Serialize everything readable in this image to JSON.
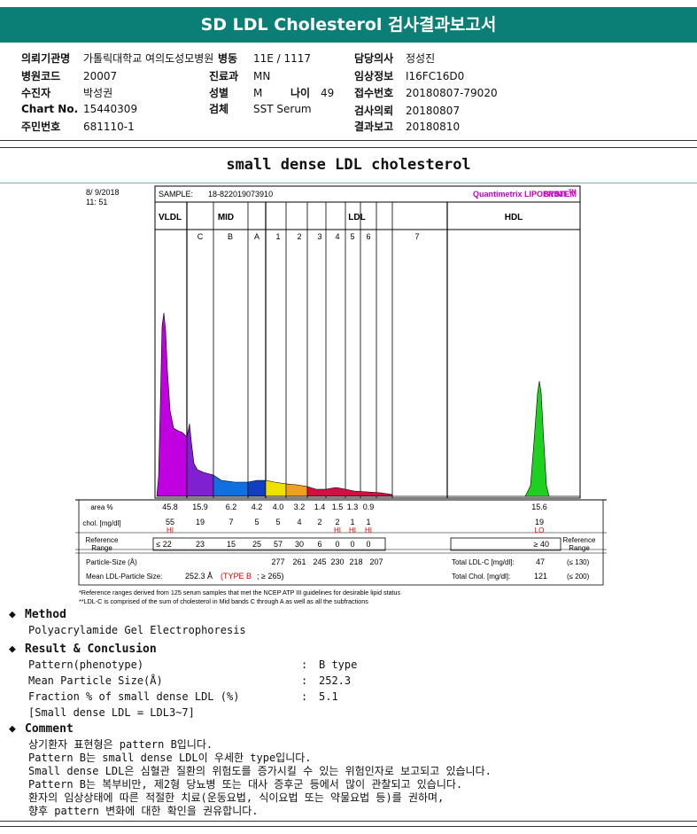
{
  "title": "SD LDL Cholesterol 검사결과보고서",
  "info": {
    "col1": [
      {
        "label": "의뢰기관명",
        "value": "가톨릭대학교 여의도성모병원"
      },
      {
        "label": "병원코드",
        "value": "20007"
      },
      {
        "label": "수진자",
        "value": "박성권"
      },
      {
        "label": "Chart No.",
        "value": "15440309"
      },
      {
        "label": "주민번호",
        "value": "681110-1"
      }
    ],
    "col2": [
      {
        "label": "병동",
        "value": "11E / 1117"
      },
      {
        "label": "진료과",
        "value": "MN"
      },
      {
        "label": "성별",
        "value": "M"
      },
      {
        "label": "검체",
        "value": "SST Serum"
      }
    ],
    "age_label": "나이",
    "age_value": "49",
    "col3": [
      {
        "label": "담당의사",
        "value": "정성진"
      },
      {
        "label": "임상정보",
        "value": "I16FC16D0"
      },
      {
        "label": "접수번호",
        "value": "20180807-79020"
      },
      {
        "label": "검사의뢰",
        "value": "20180807"
      },
      {
        "label": "결과보고",
        "value": "20180810"
      }
    ]
  },
  "subtitle": "small dense LDL cholesterol",
  "chart": {
    "date": "8/ 9/2018",
    "time": "11: 51",
    "sample_label": "SAMPLE:",
    "sample_value": "18-822019073910",
    "system_label": "Quantimetrix LIPOPRINT",
    "system_tm": "TM",
    "system_suffix": " SYSTEM",
    "group_labels": {
      "vldl": "VLDL",
      "mid": "MID",
      "ldl": "LDL",
      "hdl": "HDL"
    },
    "band_labels": [
      "C",
      "B",
      "A",
      "1",
      "2",
      "3",
      "4",
      "5",
      "6",
      "7"
    ],
    "row_labels": {
      "area": "area %",
      "chol": "chol. [mg/dl]",
      "ref": "Reference Range",
      "ref_right": "Reference Range",
      "particle": "Particle-Size (Å)",
      "mean": "Mean LDL-Particle Size:"
    },
    "area_values": [
      "45.8",
      "15.9",
      "6.2",
      "4.2",
      "4.0",
      "3.2",
      "1.4",
      "1.5",
      "1.3",
      "0.9"
    ],
    "hdl_area": "15.6",
    "chol_values": [
      "55",
      "19",
      "7",
      "5",
      "5",
      "4",
      "2",
      "2",
      "1",
      "1"
    ],
    "chol_flags": [
      "HI",
      "",
      "",
      "",
      "",
      "",
      "",
      "HI",
      "HI",
      "HI"
    ],
    "hdl_chol": "19",
    "hdl_flag": "LO",
    "ref_values": [
      "≤ 22",
      "23",
      "15",
      "25",
      "57",
      "30",
      "6",
      "0",
      "0",
      "0"
    ],
    "hdl_ref": "≥ 40",
    "particle_sizes": [
      "277",
      "261",
      "245",
      "230",
      "218",
      "207"
    ],
    "mean_value": "252.3 Å",
    "mean_type": "(TYPE B",
    "mean_suffix": "; ≥ 265)",
    "total_ldl_label": "Total LDL-C [mg/dl]:",
    "total_ldl_value": "47",
    "total_ldl_ref": "(≤ 130)",
    "total_chol_label": "Total Chol. [mg/dl]:",
    "total_chol_value": "121",
    "total_chol_ref": "(≤ 200)",
    "footnote1": "*Reference ranges derived from 125 serum samples that met the NCEP ATP III guidelines for desirable lipid status",
    "footnote2": "**LDL-C is comprised of the sum of cholesterol in Mid bands C through A as well as all the subfractions"
  },
  "method": {
    "head": "Method",
    "text": "Polyacrylamide Gel Electrophoresis"
  },
  "result": {
    "head": "Result & Conclusion",
    "rows": [
      {
        "label": "Pattern(phenotype)",
        "value": "B type"
      },
      {
        "label": "Mean Particle Size(Å)",
        "value": "252.3"
      },
      {
        "label": "Fraction % of small dense LDL (%)",
        "value": "5.1"
      }
    ],
    "note": "[Small dense LDL = LDL3~7]"
  },
  "comment": {
    "head": "Comment",
    "lines": [
      "상기환자 표현형은 pattern B입니다.",
      "Pattern B는 small dense LDL이 우세한 type입니다.",
      "Small dense LDL은 심혈관 질환의 위험도를 증가시킬 수 있는 위험인자로 보고되고 있습니다.",
      "Pattern B는 복부비만, 제2형 당뇨병 또는 대사 증후군 등에서 많이 관찰되고 있습니다.",
      "환자의 임상상태에 따른 적절한 치료(운동요법, 식이요법 또는 약물요법 등)를 권하며,",
      "향후 pattern 변화에 대한 확인을 권유합니다."
    ]
  },
  "colors": {
    "header": "#0b7f75",
    "vldl": "#c000e0",
    "mid_c": "#8020d0",
    "mid_b": "#1070e0",
    "mid_a": "#1040c0",
    "ldl1": "#f0e000",
    "ldl2": "#f0a020",
    "ldl_low": "#d01040",
    "hdl": "#20d020",
    "system": "#c000c0",
    "flag": "#e00000"
  }
}
